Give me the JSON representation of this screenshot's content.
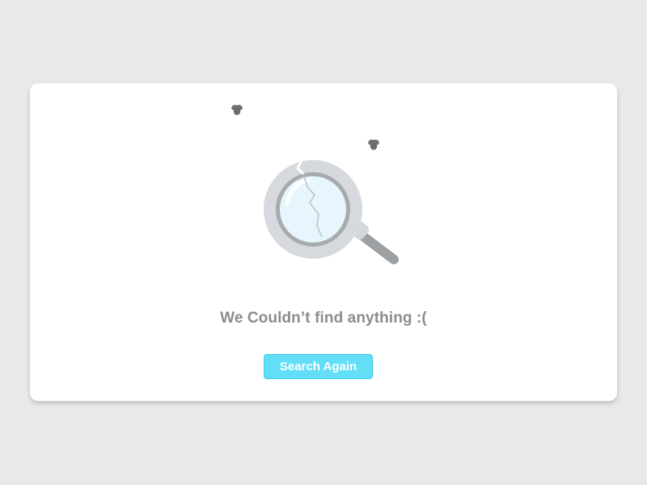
{
  "empty_state": {
    "message": "We Couldn’t find anything :(",
    "button_label": "Search Again"
  },
  "icons": {
    "illustration": "broken-magnifying-glass-icon",
    "fly_left": "fly-icon",
    "fly_right": "fly-icon"
  },
  "colors": {
    "background": "#e9e9ea",
    "card": "#ffffff",
    "message_text": "#8c8c90",
    "button_fill": "#62def6",
    "button_border": "#3fcbe9",
    "button_text": "#ffffff"
  }
}
